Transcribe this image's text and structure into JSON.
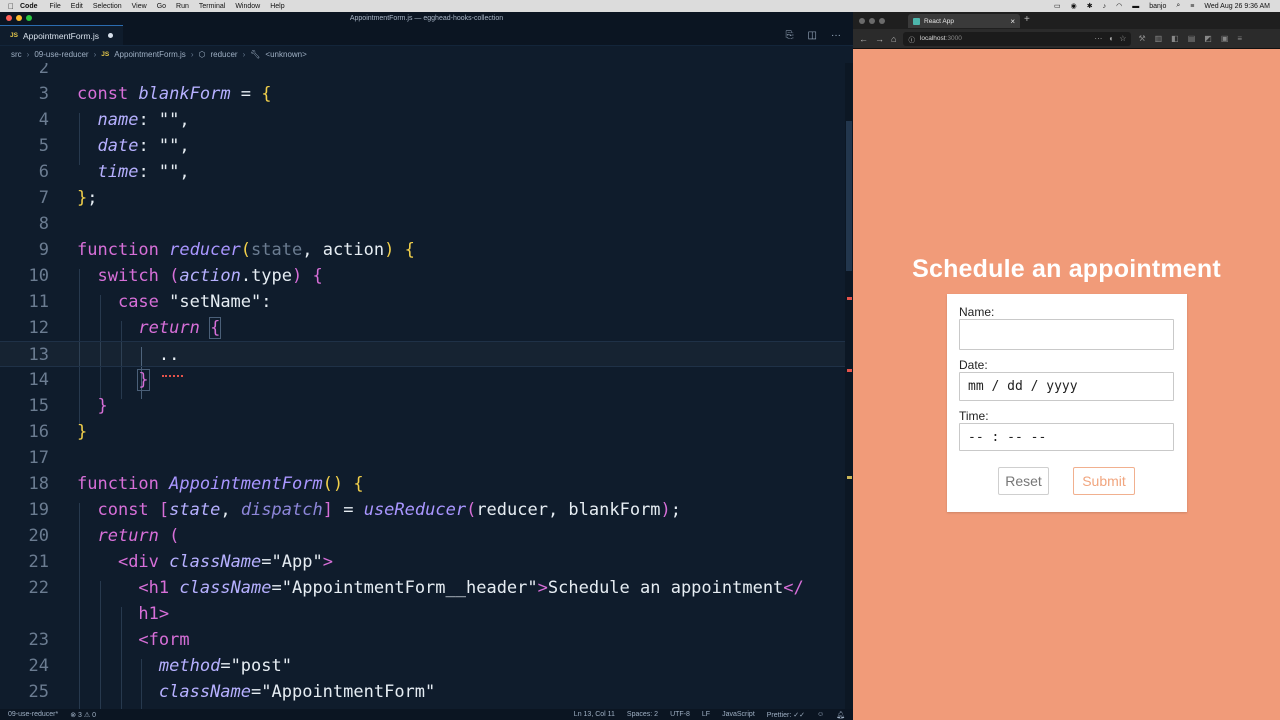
{
  "menubar": {
    "app": "Code",
    "items": [
      "File",
      "Edit",
      "Selection",
      "View",
      "Go",
      "Run",
      "Terminal",
      "Window",
      "Help"
    ],
    "user": "banjo",
    "datetime": "Wed Aug 26  9:36 AM"
  },
  "vscode": {
    "window_title": "AppointmentForm.js — egghead-hooks-collection",
    "tab": {
      "badge": "JS",
      "label": "AppointmentForm.js"
    },
    "breadcrumb": [
      "src",
      "09-use-reducer",
      "AppointmentForm.js",
      "reducer",
      "<unknown>"
    ],
    "lines": [
      {
        "n": "2",
        "t": ""
      },
      {
        "n": "3",
        "t": "const blankForm = {"
      },
      {
        "n": "4",
        "t": "  name: \"\","
      },
      {
        "n": "5",
        "t": "  date: \"\","
      },
      {
        "n": "6",
        "t": "  time: \"\","
      },
      {
        "n": "7",
        "t": "};"
      },
      {
        "n": "8",
        "t": ""
      },
      {
        "n": "9",
        "t": "function reducer(state, action) {"
      },
      {
        "n": "10",
        "t": "  switch (action.type) {"
      },
      {
        "n": "11",
        "t": "    case \"setName\":"
      },
      {
        "n": "12",
        "t": "      return {"
      },
      {
        "n": "13",
        "t": "        .."
      },
      {
        "n": "14",
        "t": "      }"
      },
      {
        "n": "15",
        "t": "  }"
      },
      {
        "n": "16",
        "t": "}"
      },
      {
        "n": "17",
        "t": ""
      },
      {
        "n": "18",
        "t": "function AppointmentForm() {"
      },
      {
        "n": "19",
        "t": "  const [state, dispatch] = useReducer(reducer, blankForm);"
      },
      {
        "n": "20",
        "t": "  return ("
      },
      {
        "n": "21",
        "t": "    <div className=\"App\">"
      },
      {
        "n": "22",
        "t": "      <h1 className=\"AppointmentForm__header\">Schedule an appointment</"
      },
      {
        "n": "",
        "t": "      h1>"
      },
      {
        "n": "23",
        "t": "      <form"
      },
      {
        "n": "24",
        "t": "        method=\"post\""
      },
      {
        "n": "25",
        "t": "        className=\"AppointmentForm\""
      }
    ],
    "status": {
      "branch": "09-use-reducer*",
      "problems": "⊗ 3 ⚠ 0",
      "cursor": "Ln 13, Col 11",
      "spaces": "Spaces: 2",
      "encoding": "UTF-8",
      "eol": "LF",
      "language": "JavaScript",
      "formatter": "Prettier: ✓✓"
    }
  },
  "browser": {
    "tab_title": "React App",
    "url_host": "localhost",
    "url_port": ":3000",
    "page_title": "Schedule an appointment",
    "form": {
      "name_label": "Name:",
      "name_value": "",
      "date_label": "Date:",
      "date_value": "mm / dd / yyyy",
      "time_label": "Time:",
      "time_value": "-- : --  --",
      "reset_label": "Reset",
      "submit_label": "Submit"
    }
  }
}
